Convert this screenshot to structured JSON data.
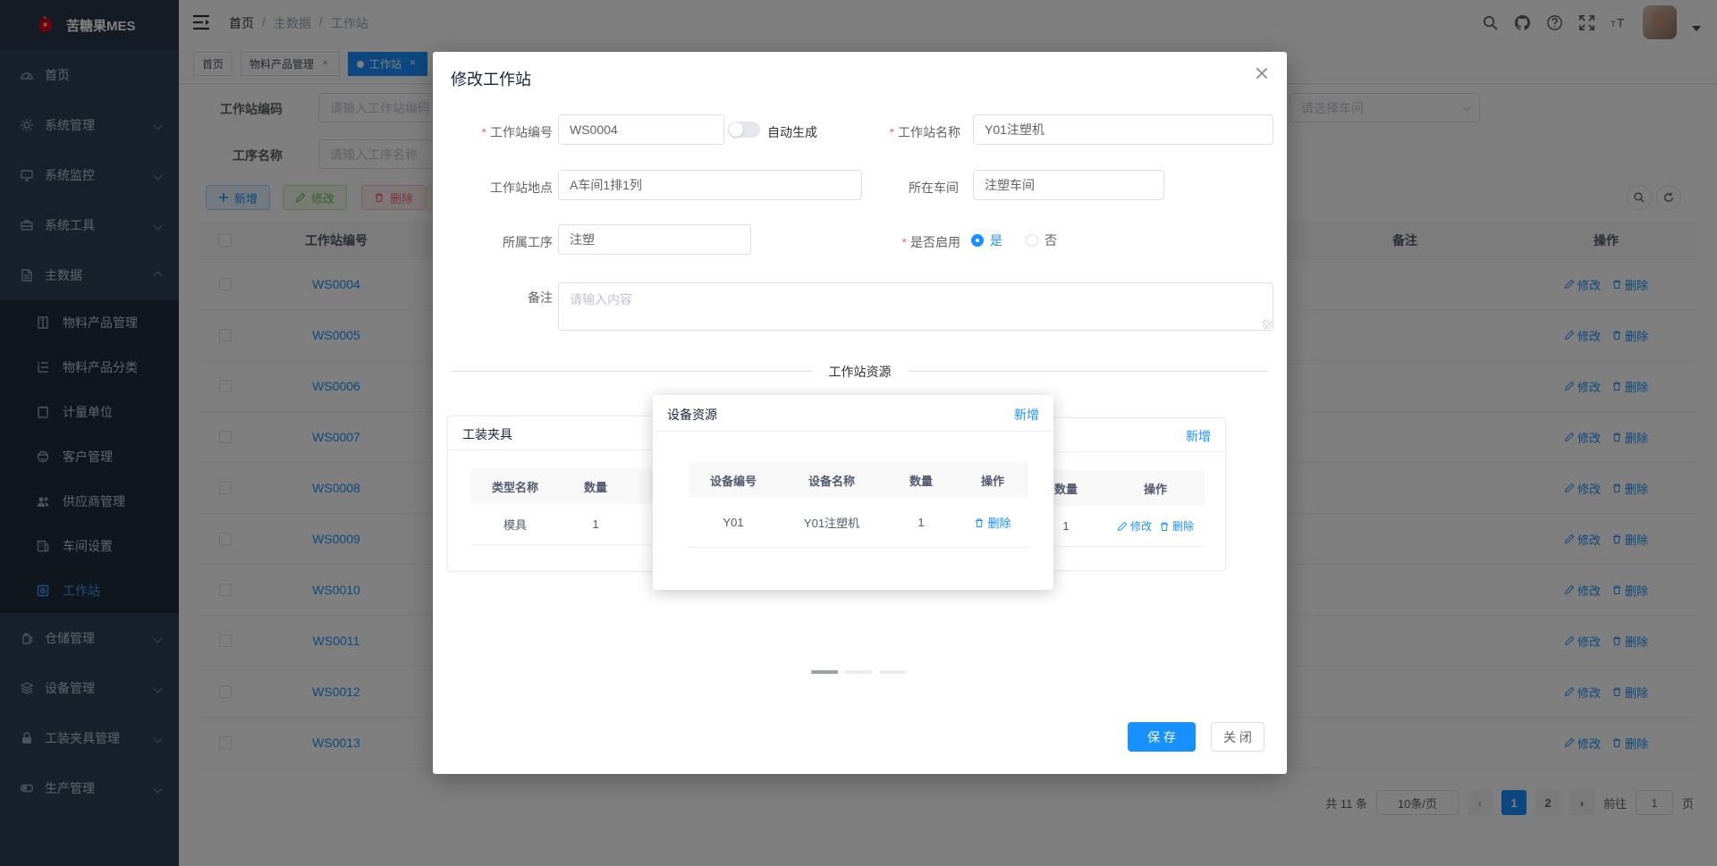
{
  "sidebar": {
    "logo": "苦糖果MES",
    "menu": [
      {
        "label": "首页"
      },
      {
        "label": "系统管理"
      },
      {
        "label": "系统监控"
      },
      {
        "label": "系统工具"
      },
      {
        "label": "主数据"
      },
      {
        "label": "仓储管理"
      },
      {
        "label": "设备管理"
      },
      {
        "label": "工装夹具管理"
      },
      {
        "label": "生产管理"
      }
    ],
    "submenu": [
      {
        "label": "物料产品管理"
      },
      {
        "label": "物料产品分类"
      },
      {
        "label": "计量单位"
      },
      {
        "label": "客户管理"
      },
      {
        "label": "供应商管理"
      },
      {
        "label": "车间设置"
      },
      {
        "label": "工作站"
      }
    ]
  },
  "header": {
    "breadcrumb": [
      "首页",
      "主数据",
      "工作站"
    ],
    "separator": "/"
  },
  "tabs": [
    {
      "label": "首页"
    },
    {
      "label": "物料产品管理"
    },
    {
      "label": "工作站"
    }
  ],
  "filters": {
    "code_label": "工作站编码",
    "code_placeholder": "请输入工作站编码",
    "process_label": "工序名称",
    "process_placeholder": "请输入工序名称",
    "workshop_placeholder": "请选择车间"
  },
  "toolbar": {
    "add": "新增",
    "edit": "修改",
    "delete": "删除"
  },
  "table": {
    "col_code": "工作站编号",
    "col_remark": "备注",
    "col_action": "操作",
    "codes": [
      "WS0004",
      "WS0005",
      "WS0006",
      "WS0007",
      "WS0008",
      "WS0009",
      "WS0010",
      "WS0011",
      "WS0012",
      "WS0013"
    ],
    "action_edit": "修改",
    "action_delete": "删除"
  },
  "pagination": {
    "total": "共 11 条",
    "page_size": "10条/页",
    "page1": "1",
    "page2": "2",
    "goto_label": "前往",
    "goto_value": "1",
    "page_suffix": "页"
  },
  "modal": {
    "title": "修改工作站",
    "fields": {
      "code_label": "工作站编号",
      "code_value": "WS0004",
      "auto_generate": "自动生成",
      "name_label": "工作站名称",
      "name_value": "Y01注塑机",
      "location_label": "工作站地点",
      "location_value": "A车间1排1列",
      "workshop_label": "所在车间",
      "workshop_value": "注塑车间",
      "process_label": "所属工序",
      "process_value": "注塑",
      "enabled_label": "是否启用",
      "enabled_yes": "是",
      "enabled_no": "否",
      "remark_label": "备注",
      "remark_placeholder": "请输入内容"
    },
    "divider": "工作站资源",
    "fixture_card": {
      "title": "工装夹具",
      "col_type": "类型名称",
      "col_qty": "数量",
      "row_type": "模具",
      "row_qty": "1"
    },
    "device_popup": {
      "title": "设备资源",
      "add": "新增",
      "col_code": "设备编号",
      "col_name": "设备名称",
      "col_qty": "数量",
      "col_action": "操作",
      "row_code": "Y01",
      "row_name": "Y01注塑机",
      "row_qty": "1",
      "action_delete": "删除"
    },
    "right_card": {
      "add": "新增",
      "col_qty": "数量",
      "col_action": "操作",
      "row_qty": "1",
      "action_edit": "修改",
      "action_delete": "删除"
    },
    "save": "保 存",
    "close": "关 闭"
  },
  "colors": {
    "primary": "#1890ff",
    "sidebar": "#304156",
    "overlay": "rgba(0,0,0,0.5)"
  }
}
